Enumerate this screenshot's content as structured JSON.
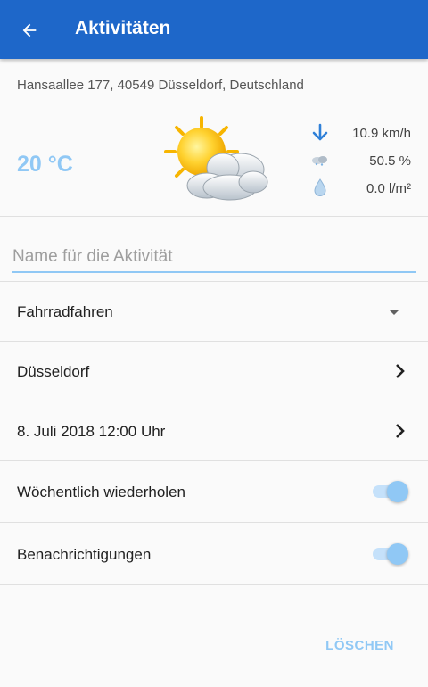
{
  "appbar": {
    "title": "Aktivitäten",
    "back_icon": "arrow-left-icon"
  },
  "weather": {
    "address": "Hansaallee 177, 40549 Düsseldorf, Deutschland",
    "temperature": "20 °C",
    "icon": "partly-cloudy-icon",
    "wind": "10.9 km/h",
    "humidity": "50.5 %",
    "precipitation": "0.0 l/m²"
  },
  "form": {
    "name_placeholder": "Name für die Aktivität",
    "name_value": "",
    "activity_type": "Fahrradfahren",
    "location": "Düsseldorf",
    "datetime": "8. Juli 2018 12:00 Uhr",
    "repeat_weekly_label": "Wöchentlich wiederholen",
    "repeat_weekly_on": true,
    "notifications_label": "Benachrichtigungen",
    "notifications_on": true
  },
  "actions": {
    "delete_label": "LÖSCHEN"
  },
  "colors": {
    "primary": "#1e67c9",
    "accent_light": "#90c8f5",
    "wind_arrow": "#2f80d8"
  }
}
